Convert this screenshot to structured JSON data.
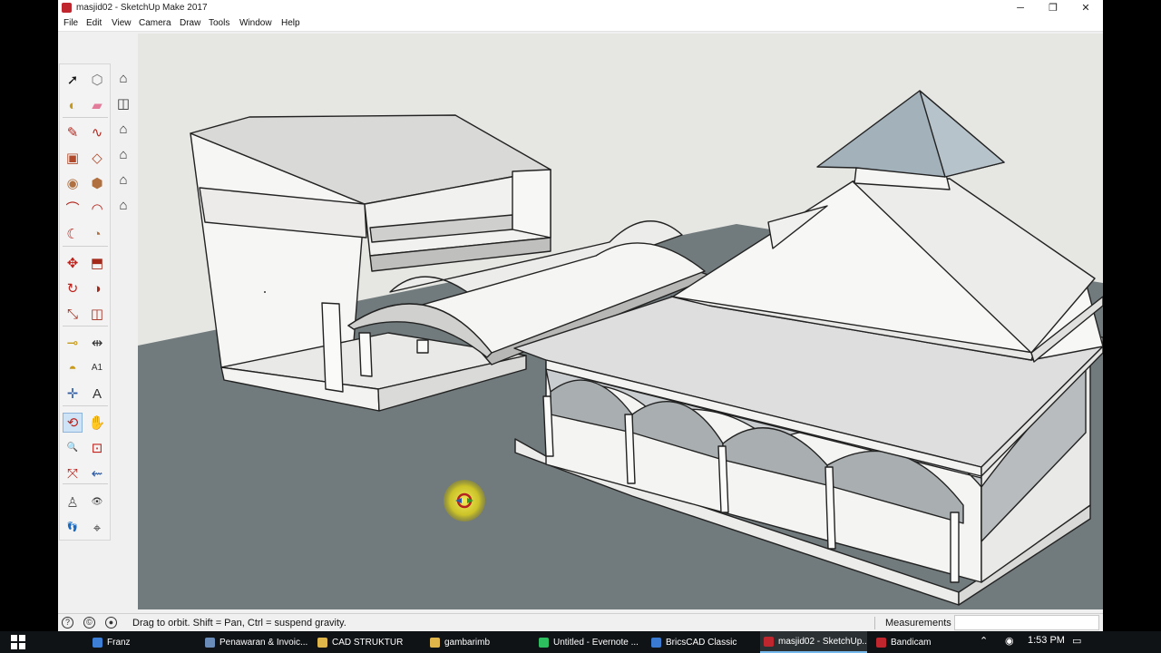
{
  "window": {
    "title": "masjid02 - SketchUp Make 2017",
    "controls": [
      "minimize",
      "restore",
      "close"
    ]
  },
  "menu": [
    "File",
    "Edit",
    "View",
    "Camera",
    "Draw",
    "Tools",
    "Window",
    "Help"
  ],
  "toolbar": {
    "tools": [
      {
        "name": "select-tool-icon",
        "glyph": "➚",
        "color": "#111111"
      },
      {
        "name": "make-component-tool-icon",
        "glyph": "⬡",
        "color": "#777777"
      },
      {
        "name": "paint-bucket-tool-icon",
        "glyph": "◐",
        "color": "#c89a1a"
      },
      {
        "name": "eraser-tool-icon",
        "glyph": "▰",
        "color": "#e37b9a"
      },
      {
        "name": "line-tool-icon",
        "glyph": "✎",
        "color": "#b3261e"
      },
      {
        "name": "freehand-tool-icon",
        "glyph": "∿",
        "color": "#b3261e"
      },
      {
        "name": "rectangle-tool-icon",
        "glyph": "▣",
        "color": "#b04a2a"
      },
      {
        "name": "rotated-rectangle-tool-icon",
        "glyph": "◇",
        "color": "#b04a2a"
      },
      {
        "name": "circle-tool-icon",
        "glyph": "◉",
        "color": "#b07040"
      },
      {
        "name": "polygon-tool-icon",
        "glyph": "⬢",
        "color": "#b07040"
      },
      {
        "name": "arc-tool-icon",
        "glyph": "⌒",
        "color": "#b3261e"
      },
      {
        "name": "two-point-arc-tool-icon",
        "glyph": "◠",
        "color": "#b3261e"
      },
      {
        "name": "three-point-arc-tool-icon",
        "glyph": "☾",
        "color": "#b3261e"
      },
      {
        "name": "pie-tool-icon",
        "glyph": "◔",
        "color": "#b07040"
      },
      {
        "name": "move-tool-icon",
        "glyph": "✥",
        "color": "#c0231d"
      },
      {
        "name": "push-pull-tool-icon",
        "glyph": "⬒",
        "color": "#a32a1b"
      },
      {
        "name": "rotate-tool-icon",
        "glyph": "↻",
        "color": "#c0231d"
      },
      {
        "name": "follow-me-tool-icon",
        "glyph": "◑",
        "color": "#a32a1b"
      },
      {
        "name": "scale-tool-icon",
        "glyph": "⤡",
        "color": "#a32a1b"
      },
      {
        "name": "offset-tool-icon",
        "glyph": "◫",
        "color": "#a32a1b"
      },
      {
        "name": "tape-measure-tool-icon",
        "glyph": "⊸",
        "color": "#c89a1a"
      },
      {
        "name": "dimension-tool-icon",
        "glyph": "⇹",
        "color": "#333333"
      },
      {
        "name": "protractor-tool-icon",
        "glyph": "◓",
        "color": "#c89a1a"
      },
      {
        "name": "text-tool-icon",
        "glyph": "A1",
        "color": "#333333"
      },
      {
        "name": "axes-tool-icon",
        "glyph": "✛",
        "color": "#2a5aa8"
      },
      {
        "name": "3d-text-tool-icon",
        "glyph": "A",
        "color": "#333333"
      },
      {
        "name": "orbit-tool-icon",
        "glyph": "⟲",
        "color": "#c0231d"
      },
      {
        "name": "pan-tool-icon",
        "glyph": "✋",
        "color": "#c89a1a"
      },
      {
        "name": "zoom-tool-icon",
        "glyph": "🔍",
        "color": "#2a5aa8"
      },
      {
        "name": "zoom-window-tool-icon",
        "glyph": "⊡",
        "color": "#c0231d"
      },
      {
        "name": "zoom-extents-tool-icon",
        "glyph": "⤧",
        "color": "#c0231d"
      },
      {
        "name": "previous-view-tool-icon",
        "glyph": "⇜",
        "color": "#2a5aa8"
      },
      {
        "name": "position-camera-tool-icon",
        "glyph": "♙",
        "color": "#555555"
      },
      {
        "name": "look-around-tool-icon",
        "glyph": "👁",
        "color": "#333333"
      },
      {
        "name": "walk-tool-icon",
        "glyph": "👣",
        "color": "#333333"
      },
      {
        "name": "section-plane-tool-icon",
        "glyph": "⌖",
        "color": "#333333"
      }
    ],
    "views": [
      {
        "name": "view-iso-icon",
        "glyph": "⌂"
      },
      {
        "name": "view-top-icon",
        "glyph": "◫"
      },
      {
        "name": "view-front-icon",
        "glyph": "⌂"
      },
      {
        "name": "view-right-icon",
        "glyph": "⌂"
      },
      {
        "name": "view-back-icon",
        "glyph": "⌂"
      },
      {
        "name": "view-left-icon",
        "glyph": "⌂"
      }
    ]
  },
  "status": {
    "icons": [
      "info-icon",
      "credit-icon",
      "user-icon"
    ],
    "text": "Drag to orbit. Shift = Pan, Ctrl = suspend gravity.",
    "measurements_label": "Measurements",
    "measurements_value": ""
  },
  "taskbar": {
    "items": [
      {
        "label": "Franz",
        "color": "#3d7fd6"
      },
      {
        "label": "Penawaran & Invoic...",
        "color": "#6a8cb8"
      },
      {
        "label": "CAD STRUKTUR",
        "color": "#e0b54a"
      },
      {
        "label": "gambarimb",
        "color": "#e0b54a"
      },
      {
        "label": "Untitled - Evernote ...",
        "color": "#2dbe60"
      },
      {
        "label": "BricsCAD Classic",
        "color": "#3a7ad0"
      },
      {
        "label": "masjid02 - SketchUp...",
        "color": "#c0262d"
      },
      {
        "label": "Bandicam",
        "color": "#c0262d"
      }
    ],
    "active_index": 6,
    "clock": "1:53 PM"
  }
}
